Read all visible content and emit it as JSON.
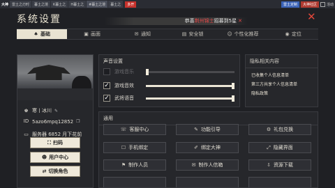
{
  "taskbar": {
    "logo": "大神",
    "tabs": [
      "雷土之刃时",
      "暮土之境",
      "K暮土之",
      "H暮土之",
      "#暮土之境",
      "暮土之"
    ],
    "red_label": "多开",
    "right_buttons": [
      "雷土定制",
      "大神社区"
    ],
    "extra": "活动"
  },
  "window": {
    "title": "系统设置"
  },
  "marquee": {
    "prefix": "恭喜",
    "highlight": "荆州锦士",
    "suffix": "招募到5星",
    "close": "✕"
  },
  "tabs": [
    {
      "label": "基础",
      "icon": "♠"
    },
    {
      "label": "画面",
      "icon": "▣"
    },
    {
      "label": "通知",
      "icon": "✉"
    },
    {
      "label": "安全锁",
      "icon": "▤"
    },
    {
      "label": "个性化推荐",
      "icon": "☺"
    },
    {
      "label": "定位",
      "icon": "◉"
    }
  ],
  "profile": {
    "name": "寒丨冰川",
    "id": "5azo6mpq12852",
    "server": "服务器 6852 月下花前",
    "buttons": [
      "扫码",
      "用户中心",
      "切换角色"
    ]
  },
  "audio": {
    "title": "声音设置",
    "rows": [
      {
        "label": "游戏音乐",
        "checked": false,
        "value": 0
      },
      {
        "label": "游戏音效",
        "checked": true,
        "value": 1.0
      },
      {
        "label": "武将语音",
        "checked": true,
        "value": 1.0
      }
    ]
  },
  "privacy": {
    "title": "隐私相关内容",
    "links": [
      "已收集个人信息清单",
      "第三方共享个人信息清单",
      "隐私政策"
    ]
  },
  "general": {
    "title": "通用",
    "buttons": [
      {
        "label": "客服中心",
        "icon": "☏"
      },
      {
        "label": "功能引导",
        "icon": "✎"
      },
      {
        "label": "礼包兑换",
        "icon": "⚙"
      },
      {
        "label": "手机绑定",
        "icon": "☐"
      },
      {
        "label": "绑定大神",
        "icon": "✐"
      },
      {
        "label": "隐藏界面",
        "icon": "⤢"
      },
      {
        "label": "制作人员",
        "icon": "⚑"
      },
      {
        "label": "制作人信箱",
        "icon": "✉"
      },
      {
        "label": "资源下载",
        "icon": "⇩"
      }
    ]
  }
}
